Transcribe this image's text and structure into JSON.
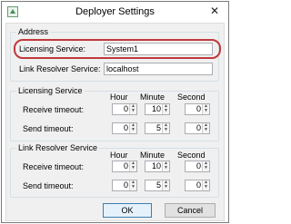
{
  "window": {
    "title": "Deployer Settings",
    "close_glyph": "✕"
  },
  "address": {
    "group_label": "Address",
    "licensing_service_label": "Licensing Service:",
    "licensing_service_value": "System1",
    "link_resolver_label": "Link Resolver Service:",
    "link_resolver_value": "localhost"
  },
  "columns": {
    "hour": "Hour",
    "minute": "Minute",
    "second": "Second"
  },
  "licensing": {
    "group_label": "Licensing Service",
    "receive_label": "Receive timeout:",
    "send_label": "Send timeout:",
    "receive": {
      "hour": "0",
      "minute": "10",
      "second": "0"
    },
    "send": {
      "hour": "0",
      "minute": "5",
      "second": "0"
    }
  },
  "link_resolver": {
    "group_label": "Link Resolver Service",
    "receive_label": "Receive timeout:",
    "send_label": "Send timeout:",
    "receive": {
      "hour": "0",
      "minute": "10",
      "second": "0"
    },
    "send": {
      "hour": "0",
      "minute": "5",
      "second": "0"
    }
  },
  "buttons": {
    "ok": "OK",
    "cancel": "Cancel"
  },
  "colors": {
    "highlight": "#c0393b",
    "ok_border": "#3c7fb1"
  },
  "icons": {
    "app": "settings-app-icon",
    "close": "close-icon",
    "spin_up": "▲",
    "spin_down": "▼"
  }
}
